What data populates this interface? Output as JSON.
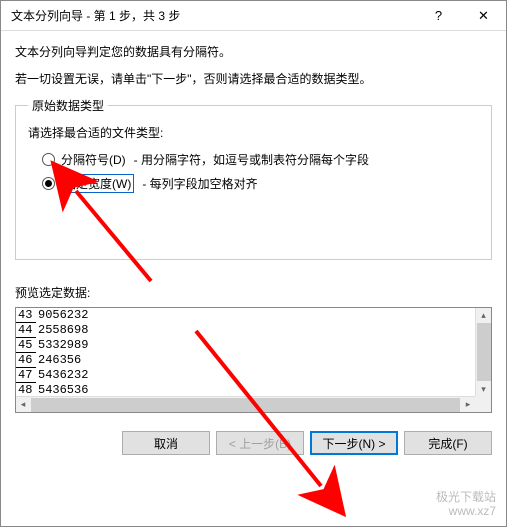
{
  "titlebar": {
    "title": "文本分列向导 - 第 1 步，共 3 步",
    "help": "?",
    "close": "✕"
  },
  "intro1": "文本分列向导判定您的数据具有分隔符。",
  "intro2": "若一切设置无误，请单击\"下一步\"，否则请选择最合适的数据类型。",
  "fieldset": {
    "legend": "原始数据类型",
    "prompt": "请选择最合适的文件类型:",
    "opt1": {
      "label": "分隔符号(D)",
      "desc": "- 用分隔字符，如逗号或制表符分隔每个字段"
    },
    "opt2": {
      "label": "固定宽度(W)",
      "desc": "- 每列字段加空格对齐"
    }
  },
  "preview": {
    "label": "预览选定数据:",
    "rows": [
      {
        "n": "43",
        "v": "9056232"
      },
      {
        "n": "44",
        "v": "2558698"
      },
      {
        "n": "45",
        "v": "5332989"
      },
      {
        "n": "46",
        "v": "246356"
      },
      {
        "n": "47",
        "v": "5436232"
      },
      {
        "n": "48",
        "v": "5436536"
      }
    ]
  },
  "buttons": {
    "cancel": "取消",
    "back": "< 上一步(B)",
    "next": "下一步(N) >",
    "finish": "完成(F)"
  },
  "watermark": {
    "line1": "极光下载站",
    "line2": "www.xz7"
  }
}
